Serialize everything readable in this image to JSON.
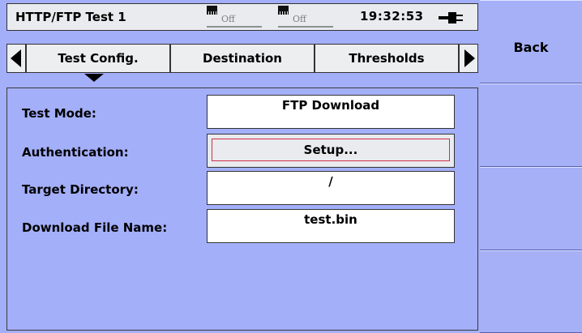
{
  "status": {
    "title": "HTTP/FTP Test 1",
    "port1_state": "Off",
    "port2_state": "Off",
    "time": "19:32:53",
    "port_icon": "ethernet-port-icon",
    "power_icon": "power-plug-icon"
  },
  "tabs": {
    "items": [
      {
        "label": "Test Config."
      },
      {
        "label": "Destination"
      },
      {
        "label": "Thresholds"
      }
    ],
    "active_index": 0,
    "left_icon": "triangle-left-icon",
    "right_icon": "triangle-right-icon"
  },
  "form": {
    "test_mode_label": "Test Mode:",
    "test_mode_value": "FTP Download",
    "authentication_label": "Authentication:",
    "authentication_button": "Setup...",
    "target_directory_label": "Target Directory:",
    "target_directory_value": "/",
    "download_file_label": "Download File Name:",
    "download_file_value": "test.bin"
  },
  "softkeys": {
    "back_label": "Back"
  },
  "colors": {
    "background": "#a4affa",
    "softkey": "#a5b0f7",
    "focus_border": "#d0304a",
    "field": "#ffffff"
  }
}
